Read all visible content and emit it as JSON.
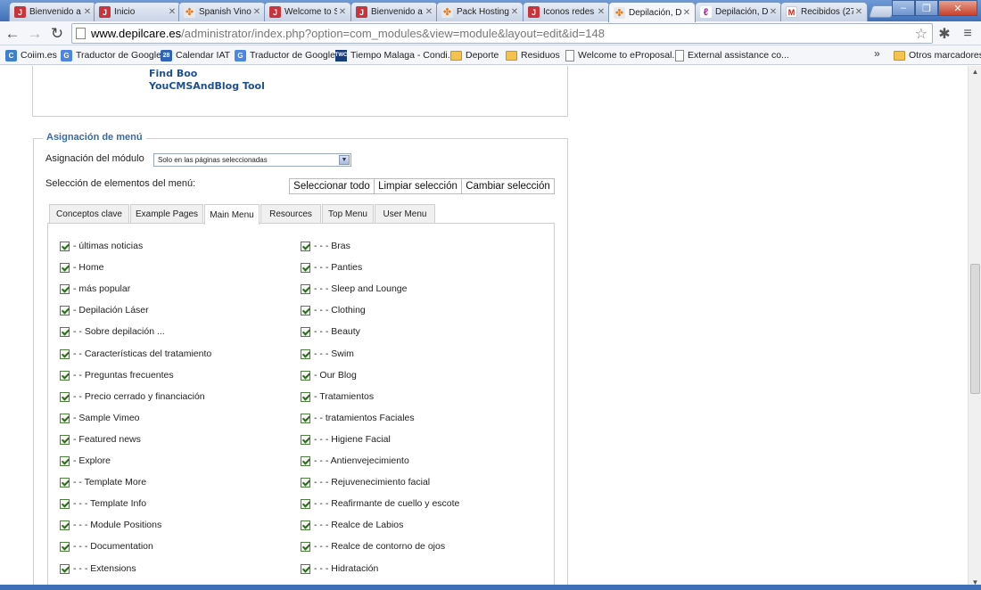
{
  "browser": {
    "tabs": [
      {
        "label": "Bienvenido a",
        "icon": "joomla-red-icon"
      },
      {
        "label": "Inicio",
        "icon": "joomla-red-icon"
      },
      {
        "label": "Spanish Vinol",
        "icon": "joomla-orange-icon"
      },
      {
        "label": "Welcome to S",
        "icon": "joomla-red-icon"
      },
      {
        "label": "Bienvenido a",
        "icon": "joomla-red-icon"
      },
      {
        "label": "Pack Hosting",
        "icon": "joomla-orange-icon"
      },
      {
        "label": "Iconos redes",
        "icon": "joomla-red-icon"
      },
      {
        "label": "Depilación, D",
        "icon": "joomla-orange-icon",
        "active": true
      },
      {
        "label": "Depilación, D",
        "icon": "depilcare-icon"
      },
      {
        "label": "Recibidos (27",
        "icon": "gmail-icon"
      }
    ],
    "url_host": "www.depilcare.es",
    "url_path": "/administrator/index.php?option=com_modules&view=module&layout=edit&id=148",
    "bookmarks": [
      {
        "label": "Coiim.es",
        "icon": "coiim-icon"
      },
      {
        "label": "Traductor de Google",
        "icon": "google-translate-icon"
      },
      {
        "label": "Calendar IAT",
        "icon": "calendar-icon"
      },
      {
        "label": "Traductor de Google",
        "icon": "google-translate-icon"
      },
      {
        "label": "Tiempo Malaga - Condi...",
        "icon": "twc-icon"
      },
      {
        "label": "Deporte",
        "icon": "folder-icon"
      },
      {
        "label": "Residuos",
        "icon": "folder-icon"
      },
      {
        "label": "Welcome to eProposal.",
        "icon": "page-icon"
      },
      {
        "label": "External assistance co...",
        "icon": "page-icon"
      }
    ],
    "bookmarks_more": "»",
    "other_bookmarks": "Otros marcadores"
  },
  "page": {
    "top_links": [
      "Find Boo",
      "YouCMSAndBlog Tool"
    ],
    "menu_assignment": {
      "legend": "Asignación de menú",
      "module_assignment_label": "Asignación del módulo",
      "module_assignment_value": "Solo en las páginas seleccionadas",
      "menu_selection_label": "Selección de elementos del menú:",
      "buttons": [
        "Seleccionar todo",
        "Limpiar selección",
        "Cambiar selección"
      ],
      "tabs": [
        "Conceptos clave",
        "Example Pages",
        "Main Menu",
        "Resources",
        "Top Menu",
        "User Menu"
      ],
      "active_tab": "Main Menu",
      "left_items": [
        "- últimas noticias",
        "- Home",
        "- más popular",
        "- Depilación Láser",
        "- - Sobre depilación ...",
        "- - Características del tratamiento",
        "- - Preguntas frecuentes",
        "- - Precio cerrado y financiación",
        "- Sample Vimeo",
        "- Featured news",
        "- Explore",
        "- - Template More",
        "- - - Template Info",
        "- - - Module Positions",
        "- - - Documentation",
        "- - - Extensions"
      ],
      "right_items": [
        "- - - Bras",
        "- - - Panties",
        "- - - Sleep and Lounge",
        "- - - Clothing",
        "- - - Beauty",
        "- - - Swim",
        "- Our Blog",
        "- Tratamientos",
        "- - tratamientos Faciales",
        "- - - Higiene Facial",
        "- - - Antienvejecimiento",
        "- - - Rejuvenecimiento facial",
        "- - - Reafirmante de cuello y escote",
        "- - - Realce de Labios",
        "- - - Realce de contorno de ojos",
        "- - - Hidratación"
      ],
      "all_checked": true
    }
  }
}
